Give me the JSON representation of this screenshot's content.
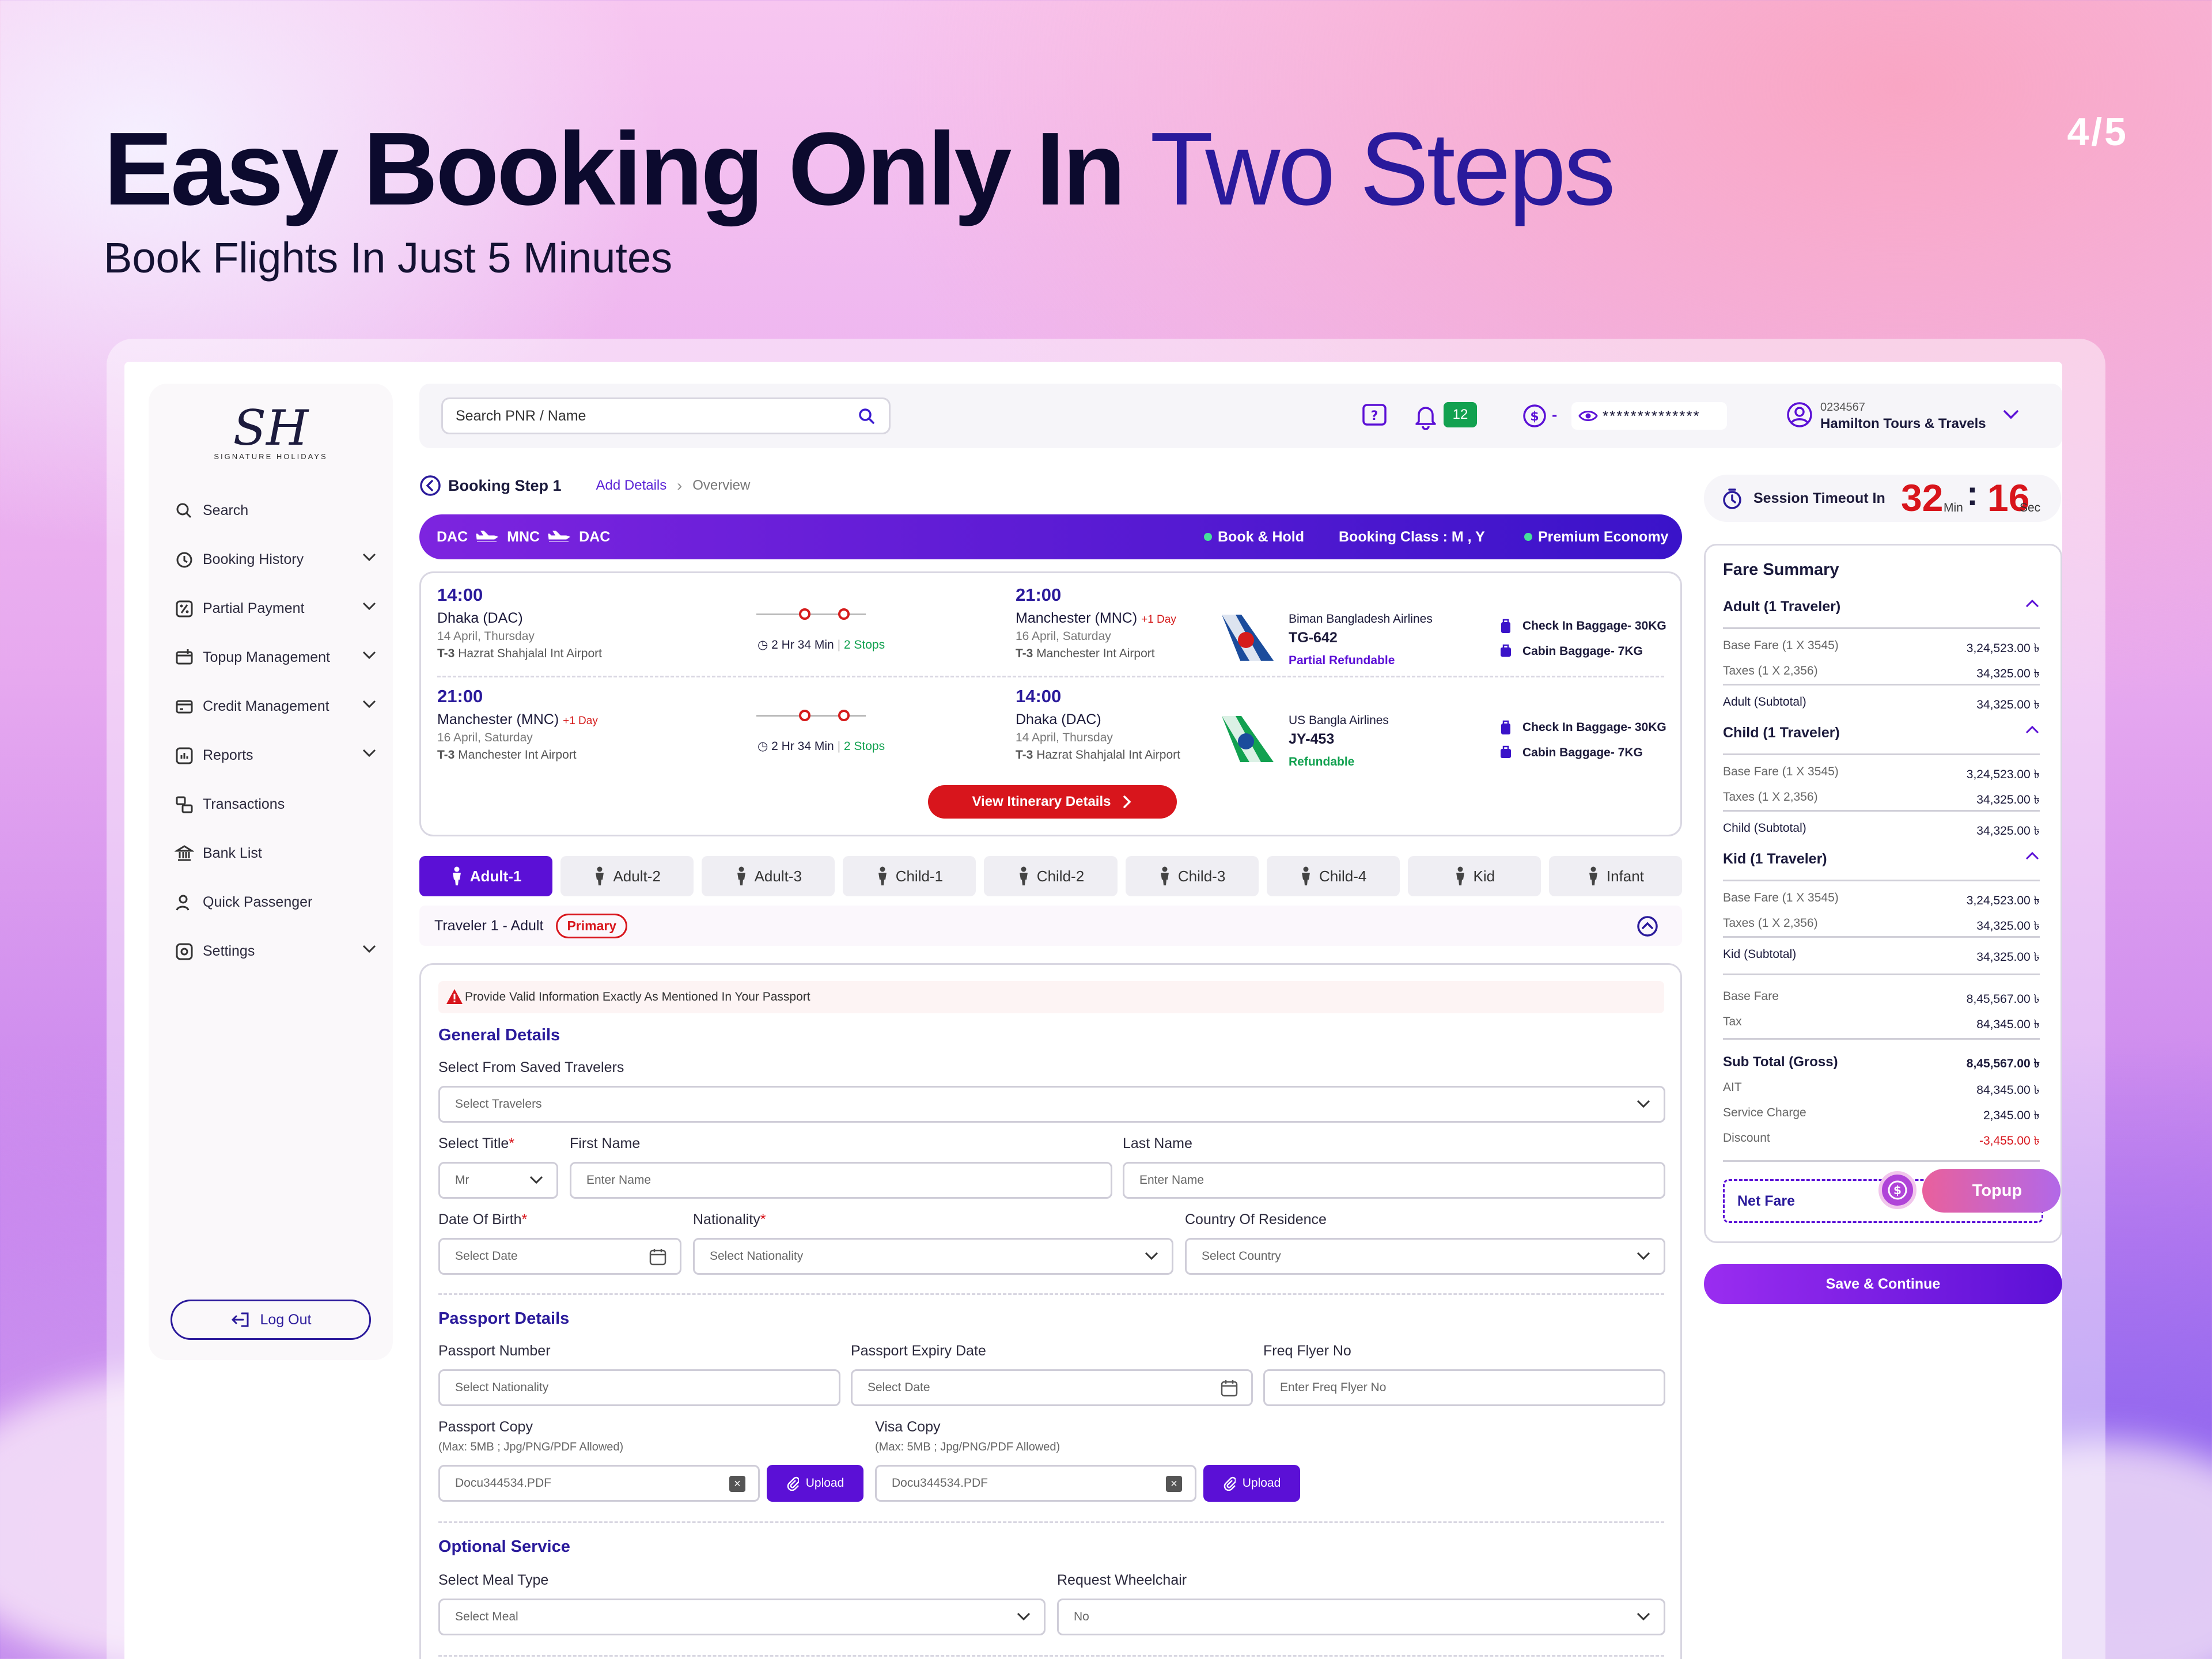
{
  "hero": {
    "title_bold": "Easy Booking Only In",
    "title_light": "Two Steps",
    "subtitle": "Book Flights In Just 5 Minutes",
    "pager": "4/5"
  },
  "logo": {
    "mark": "SH",
    "sub": "SIGNATURE HOLIDAYS"
  },
  "sidebar": {
    "items": [
      {
        "label": "Search",
        "icon": "search-icon",
        "chevron": false
      },
      {
        "label": "Booking History",
        "icon": "history-icon",
        "chevron": true
      },
      {
        "label": "Partial  Payment",
        "icon": "percent-icon",
        "chevron": true
      },
      {
        "label": "Topup Management",
        "icon": "topup-icon",
        "chevron": true
      },
      {
        "label": "Credit Management",
        "icon": "card-icon",
        "chevron": true
      },
      {
        "label": "Reports",
        "icon": "report-icon",
        "chevron": true
      },
      {
        "label": "Transactions",
        "icon": "transactions-icon",
        "chevron": false
      },
      {
        "label": "Bank List",
        "icon": "bank-icon",
        "chevron": false
      },
      {
        "label": "Quick Passenger",
        "icon": "passenger-icon",
        "chevron": false
      },
      {
        "label": "Settings",
        "icon": "settings-icon",
        "chevron": true
      }
    ],
    "logout": "Log Out"
  },
  "topbar": {
    "search_placeholder": "Search PNR / Name",
    "notif_count": "12",
    "balance_dash": "-",
    "balance_masked": "**************",
    "account_id": "0234567",
    "account_name": "Hamilton Tours & Travels"
  },
  "breadcrumb": {
    "title": "Booking Step 1",
    "step": "Add Details",
    "step2": "Overview"
  },
  "route": {
    "from": "DAC",
    "via": "MNC",
    "to": "DAC",
    "hold": "Book & Hold",
    "booking_class": "Booking Class : M , Y",
    "cabin": "Premium Economy"
  },
  "legs": [
    {
      "dep_time": "14:00",
      "dep_city": "Dhaka (DAC)",
      "dep_date": "14 April, Thursday",
      "dep_term_code": "T-3",
      "dep_term": "Hazrat Shahjalal Int Airport",
      "duration": "2 Hr 34 Min",
      "stops": "2 Stops",
      "arr_time": "21:00",
      "arr_city": "Manchester (MNC)",
      "arr_plus": "+1 Day",
      "arr_date": "16 April, Saturday",
      "arr_term_code": "T-3",
      "arr_term": "Manchester Int Airport",
      "airline": "Biman Bangladesh Airlines",
      "flight_no": "TG-642",
      "refund": "Partial Refundable",
      "checkin": "Check In Baggage- 30KG",
      "cabin_bag": "Cabin Baggage- 7KG"
    },
    {
      "dep_time": "21:00",
      "dep_city": "Manchester (MNC)",
      "dep_plus": "+1 Day",
      "dep_date": "16 April, Saturday",
      "dep_term_code": "T-3",
      "dep_term": "Manchester Int Airport",
      "duration": "2 Hr 34 Min",
      "stops": "2 Stops",
      "arr_time": "14:00",
      "arr_city": "Dhaka (DAC)",
      "arr_date": "14 April, Thursday",
      "arr_term_code": "T-3",
      "arr_term": "Hazrat Shahjalal Int Airport",
      "airline": "US Bangla Airlines",
      "flight_no": "JY-453",
      "refund": "Refundable",
      "checkin": "Check In Baggage- 30KG",
      "cabin_bag": "Cabin Baggage- 7KG"
    }
  ],
  "view_itinerary": "View Itinerary Details",
  "tabs": [
    "Adult-1",
    "Adult-2",
    "Adult-3",
    "Child-1",
    "Child-2",
    "Child-3",
    "Child-4",
    "Kid",
    "Infant"
  ],
  "traveler": {
    "label": "Traveler 1 - Adult",
    "badge": "Primary"
  },
  "form": {
    "warning": "Provide Valid Information Exactly As Mentioned In Your Passport",
    "general_title": "General Details",
    "saved_label": "Select From Saved Travelers",
    "saved_placeholder": "Select Travelers",
    "title_label": "Select Title",
    "title_value": "Mr",
    "first_label": "First Name",
    "first_placeholder": "Enter Name",
    "last_label": "Last Name",
    "last_placeholder": "Enter Name",
    "dob_label": "Date Of Birth",
    "dob_placeholder": "Select Date",
    "nat_label": "Nationality",
    "nat_placeholder": "Select Nationality",
    "cor_label": "Country Of Residence",
    "cor_placeholder": "Select Country",
    "passport_title": "Passport Details",
    "pnum_label": "Passport Number",
    "pnum_placeholder": "Select Nationality",
    "pexp_label": "Passport Expiry Date",
    "pexp_placeholder": "Select Date",
    "ff_label": "Freq Flyer No",
    "ff_placeholder": "Enter Freq Flyer No",
    "pcopy_label": "Passport Copy",
    "pcopy_hint": "(Max: 5MB ; Jpg/PNG/PDF Allowed)",
    "pcopy_file": "Docu344534.PDF",
    "vcopy_label": "Visa Copy",
    "vcopy_hint": "(Max: 5MB ; Jpg/PNG/PDF Allowed)",
    "vcopy_file": "Docu344534.PDF",
    "upload": "Upload",
    "optional_title": "Optional Service",
    "meal_label": "Select Meal Type",
    "meal_placeholder": "Select Meal",
    "wheel_label": "Request Wheelchair",
    "wheel_value": "No"
  },
  "session": {
    "label": "Session Timeout In",
    "min": "32",
    "min_unit": "Min",
    "sep": ":",
    "sec": "16",
    "sec_unit": "Sec"
  },
  "fare": {
    "title": "Fare Summary",
    "groups": [
      {
        "title": "Adult (1 Traveler)",
        "base_label": "Base Fare (1 X 3545)",
        "base": "3,24,523.00 ৳",
        "tax_label": "Taxes (1 X 2,356)",
        "tax": "34,325.00 ৳",
        "sub_label": "Adult (Subtotal)",
        "sub": "34,325.00 ৳"
      },
      {
        "title": "Child (1 Traveler)",
        "base_label": "Base Fare (1 X 3545)",
        "base": "3,24,523.00 ৳",
        "tax_label": "Taxes (1 X 2,356)",
        "tax": "34,325.00 ৳",
        "sub_label": "Child (Subtotal)",
        "sub": "34,325.00 ৳"
      },
      {
        "title": "Kid (1 Traveler)",
        "base_label": "Base Fare (1 X 3545)",
        "base": "3,24,523.00 ৳",
        "tax_label": "Taxes (1 X 2,356)",
        "tax": "34,325.00 ৳",
        "sub_label": "Kid (Subtotal)",
        "sub": "34,325.00 ৳"
      }
    ],
    "base_fare_label": "Base Fare",
    "base_fare": "8,45,567.00 ৳",
    "tax_label": "Tax",
    "tax": "84,345.00 ৳",
    "gross_label": "Sub Total (Gross)",
    "gross": "8,45,567.00 ৳",
    "ait_label": "AIT",
    "ait": "84,345.00 ৳",
    "service_label": "Service Charge",
    "service": "2,345.00 ৳",
    "discount_label": "Discount",
    "discount": "-3,455.00 ৳",
    "net_label": "Net Fare",
    "topup": "Topup"
  },
  "save_continue": "Save & Continue",
  "colors": {
    "primary": "#5b10d6",
    "accent_red": "#d8151c",
    "success": "#12a150",
    "navy": "#2a1a9b"
  }
}
